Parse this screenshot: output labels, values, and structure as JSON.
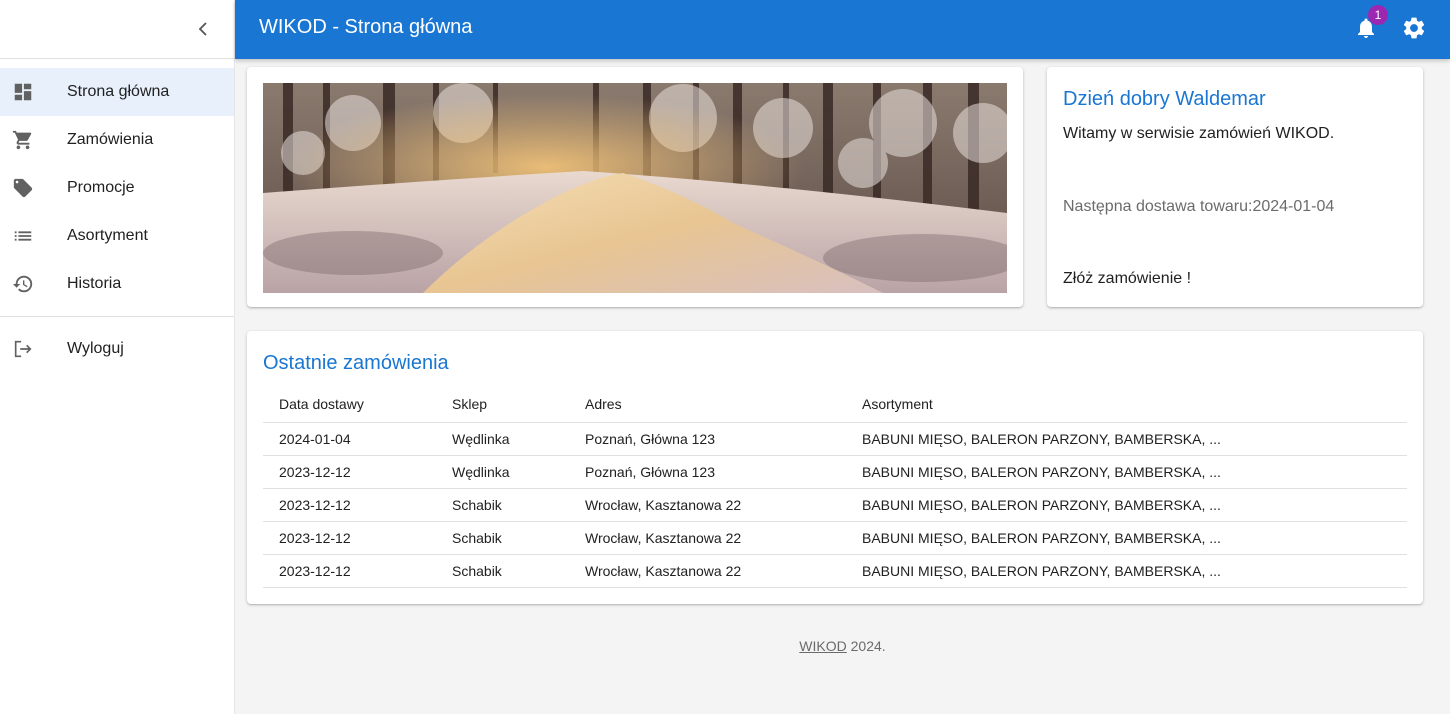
{
  "app": {
    "title": "WIKOD - Strona główna"
  },
  "notifications": {
    "count": "1"
  },
  "sidebar": {
    "items": [
      {
        "label": "Strona główna",
        "icon": "dashboard-icon",
        "active": true
      },
      {
        "label": "Zamówienia",
        "icon": "cart-icon"
      },
      {
        "label": "Promocje",
        "icon": "tag-icon"
      },
      {
        "label": "Asortyment",
        "icon": "list-icon"
      },
      {
        "label": "Historia",
        "icon": "history-icon"
      }
    ],
    "logout_label": "Wyloguj"
  },
  "welcome": {
    "title": "Dzień dobry Waldemar",
    "text": "Witamy w serwisie zamówień WIKOD.",
    "next_delivery": "Następna dostawa towaru:2024-01-04",
    "order_link": "Złóż zamówienie !"
  },
  "orders": {
    "title": "Ostatnie zamówienia",
    "columns": [
      "Data dostawy",
      "Sklep",
      "Adres",
      "Asortyment"
    ],
    "rows": [
      [
        "2024-01-04",
        "Wędlinka",
        "Poznań, Główna 123",
        "BABUNI MIĘSO, BALERON PARZONY, BAMBERSKA, ..."
      ],
      [
        "2023-12-12",
        "Wędlinka",
        "Poznań, Główna 123",
        "BABUNI MIĘSO, BALERON PARZONY, BAMBERSKA, ..."
      ],
      [
        "2023-12-12",
        "Schabik",
        "Wrocław, Kasztanowa 22",
        "BABUNI MIĘSO, BALERON PARZONY, BAMBERSKA, ..."
      ],
      [
        "2023-12-12",
        "Schabik",
        "Wrocław, Kasztanowa 22",
        "BABUNI MIĘSO, BALERON PARZONY, BAMBERSKA, ..."
      ],
      [
        "2023-12-12",
        "Schabik",
        "Wrocław, Kasztanowa 22",
        "BABUNI MIĘSO, BALERON PARZONY, BAMBERSKA, ..."
      ]
    ]
  },
  "footer": {
    "link": "WIKOD",
    "year": " 2024."
  },
  "colors": {
    "primary": "#1976d2",
    "badge": "#9c27b0",
    "active_bg": "#e8f0fb"
  }
}
